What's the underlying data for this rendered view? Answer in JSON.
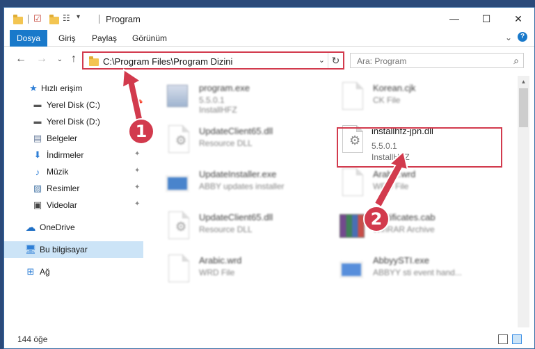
{
  "window": {
    "title": "Program"
  },
  "ribbon": {
    "tabs": [
      "Dosya",
      "Giriş",
      "Paylaş",
      "Görünüm"
    ]
  },
  "address": {
    "path": "C:\\Program Files\\Program Dizini"
  },
  "search": {
    "placeholder": "Ara: Program"
  },
  "sidebar": {
    "items": [
      {
        "label": "Hızlı erişim",
        "icon": "star-icon"
      },
      {
        "label": "Yerel Disk (C:)",
        "icon": "drive-icon"
      },
      {
        "label": "Yerel Disk (D:)",
        "icon": "drive-icon"
      },
      {
        "label": "Belgeler",
        "icon": "documents-icon"
      },
      {
        "label": "İndirmeler",
        "icon": "download-icon"
      },
      {
        "label": "Müzik",
        "icon": "music-icon"
      },
      {
        "label": "Resimler",
        "icon": "pictures-icon"
      },
      {
        "label": "Videolar",
        "icon": "videos-icon"
      },
      {
        "label": "OneDrive",
        "icon": "cloud-icon"
      },
      {
        "label": "Bu bilgisayar",
        "icon": "computer-icon"
      },
      {
        "label": "Ağ",
        "icon": "network-icon"
      }
    ]
  },
  "files": [
    {
      "name": "program.exe",
      "line1": "5.5.0.1",
      "line2": "InstallHFZ"
    },
    {
      "name": "Korean.cjk",
      "line1": "CK File",
      "line2": ""
    },
    {
      "name": "UpdateClient65.dll",
      "line1": "Resource DLL",
      "line2": ""
    },
    {
      "name": "installhfz-jpn.dll",
      "line1": "5.5.0.1",
      "line2": "InstallHFZ"
    },
    {
      "name": "UpdateInstaller.exe",
      "line1": "ABBY updates installer",
      "line2": ""
    },
    {
      "name": "Arabic.wrd",
      "line1": "WRD File",
      "line2": ""
    },
    {
      "name": "UpdateClient65.dll",
      "line1": "Resource DLL",
      "line2": ""
    },
    {
      "name": "Certificates.cab",
      "line1": "WinRAR Archive",
      "line2": ""
    },
    {
      "name": "Arabic.wrd",
      "line1": "WRD File",
      "line2": ""
    },
    {
      "name": "AbbyySTI.exe",
      "line1": "ABBYY sti event hand...",
      "line2": ""
    }
  ],
  "status": {
    "item_count": "144 öğe"
  },
  "annotations": {
    "first": "1",
    "second": "2"
  },
  "colors": {
    "accent": "#1979ca",
    "highlight": "#d23a4d",
    "selected": "#cce4f7"
  }
}
